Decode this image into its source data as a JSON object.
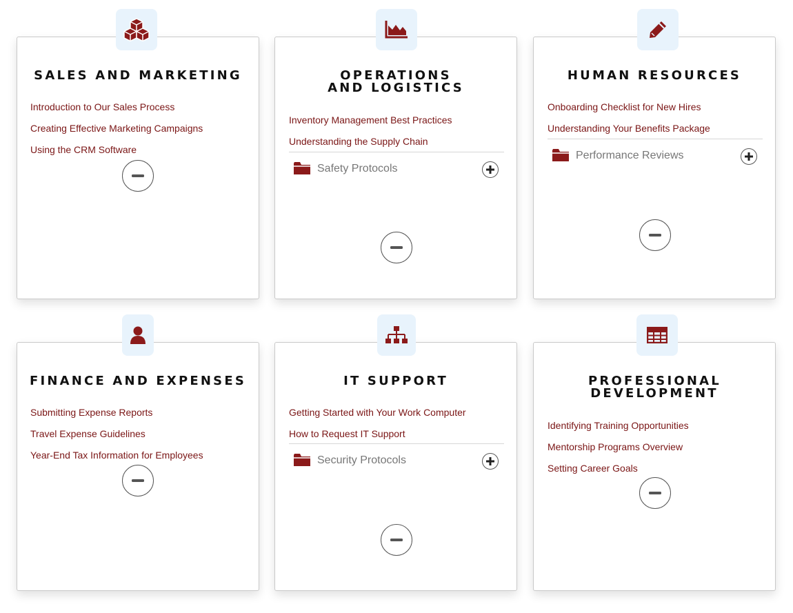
{
  "accent_color": "#8b1a1a",
  "badge_color": "#e8f3fc",
  "cards": [
    {
      "icon": "cubes-icon",
      "title": "SALES AND MARKETING",
      "links": [
        "Introduction to Our Sales Process",
        "Creating Effective Marketing Campaigns",
        "Using the CRM Software"
      ],
      "folder": null
    },
    {
      "icon": "area-chart-icon",
      "title": "OPERATIONS AND LOGISTICS",
      "links": [
        "Inventory Management Best Practices",
        "Understanding the Supply Chain"
      ],
      "folder": "Safety Protocols"
    },
    {
      "icon": "pencil-icon",
      "title": "HUMAN RESOURCES",
      "links": [
        "Onboarding Checklist for New Hires",
        "Understanding Your Benefits Package"
      ],
      "folder": "Performance Reviews"
    },
    {
      "icon": "user-icon",
      "title": "FINANCE AND EXPENSES",
      "links": [
        "Submitting Expense Reports",
        "Travel Expense Guidelines",
        "Year-End Tax Information for Employees"
      ],
      "folder": null
    },
    {
      "icon": "sitemap-icon",
      "title": "IT SUPPORT",
      "links": [
        "Getting Started with Your Work Computer",
        "How to Request IT Support"
      ],
      "folder": "Security Protocols"
    },
    {
      "icon": "table-icon",
      "title": "PROFESSIONAL DEVELOPMENT",
      "links": [
        "Identifying Training Opportunities",
        "Mentorship Programs Overview",
        "Setting Career Goals"
      ],
      "folder": null
    }
  ]
}
